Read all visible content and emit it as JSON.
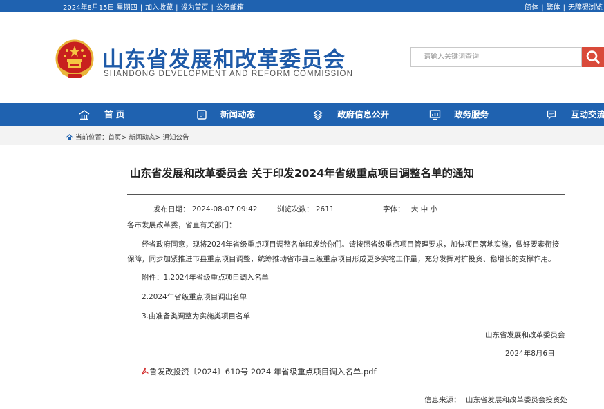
{
  "topbar": {
    "date": "2024年8月15日 星期四",
    "add_favorite": "加入收藏",
    "set_homepage": "设为首页",
    "public_mail": "公务邮箱",
    "simplified": "简体",
    "traditional": "繁体",
    "accessible": "无障碍浏览"
  },
  "header": {
    "title": "山东省发展和改革委员会",
    "subtitle": "SHANDONG DEVELOPMENT AND REFORM COMMISSION",
    "search_placeholder": "请输入关键词查询"
  },
  "nav": {
    "items": [
      {
        "label": "首    页",
        "icon": "home-icon"
      },
      {
        "label": "新闻动态",
        "icon": "news-icon"
      },
      {
        "label": "政府信息公开",
        "icon": "layers-icon"
      },
      {
        "label": "政务服务",
        "icon": "chart-icon"
      },
      {
        "label": "互动交流",
        "icon": "chat-icon"
      }
    ]
  },
  "breadcrumb": {
    "prefix": "当前位置：",
    "home": "首页",
    "news": "新闻动态",
    "notice": "通知公告",
    "sep": ">"
  },
  "article": {
    "title": "山东省发展和改革委员会 关于印发2024年省级重点项目调整名单的通知",
    "publish_label": "发布日期：",
    "publish_date": "2024-08-07 09:42",
    "views_label": "浏览次数：",
    "views": "2611",
    "font_label": "字体：",
    "font_large": "大",
    "font_medium": "中",
    "font_small": "小",
    "salutation": "各市发展改革委，省直有关部门：",
    "para1_line1": "经省政府同意，现将2024年省级重点项目调整名单印发给你们。请按照省级重点项目管理要求，加快项目落地实施，做好要素衔接",
    "para1_line2": "保障，同步加紧推进市县重点项目调整，统筹推动省市县三级重点项目形成更多实物工作量，充分发挥对扩投资、稳增长的支撑作用。",
    "attachment1": "附件：1.2024年省级重点项目调入名单",
    "attachment2": "2.2024年省级重点项目调出名单",
    "attachment3": "3.由准备类调整为实施类项目名单",
    "signer": "山东省发展和改革委员会",
    "sign_date": "2024年8月6日",
    "pdf_file": "鲁发改投资〔2024〕610号 2024 年省级重点项目调入名单.pdf",
    "source_label": "信息来源：",
    "source": "山东省发展和改革委员会投资处"
  },
  "colors": {
    "brand_blue": "#1f62b0",
    "search_red": "#d94a3a"
  }
}
